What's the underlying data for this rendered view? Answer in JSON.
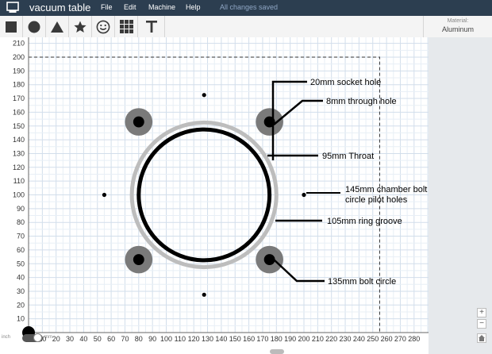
{
  "app": {
    "title": "vacuum table",
    "menu": [
      "File",
      "Edit",
      "Machine",
      "Help"
    ],
    "status": "All changes saved"
  },
  "toolbar": {
    "tools": [
      {
        "name": "rectangle-tool",
        "icon": "square-icon"
      },
      {
        "name": "circle-tool",
        "icon": "circle-icon"
      },
      {
        "name": "triangle-tool",
        "icon": "triangle-icon"
      },
      {
        "name": "star-tool",
        "icon": "star-icon"
      },
      {
        "name": "emoji-tool",
        "icon": "smiley-icon"
      },
      {
        "name": "grid-tool",
        "icon": "grid-icon"
      },
      {
        "name": "text-tool",
        "icon": "text-icon"
      }
    ],
    "material_label": "Material:",
    "material_value": "Aluminum"
  },
  "axis": {
    "x_ticks": [
      10,
      20,
      30,
      40,
      50,
      60,
      70,
      80,
      90,
      100,
      110,
      120,
      130,
      140,
      150,
      160,
      170,
      180,
      190,
      200,
      210,
      220,
      230,
      240,
      250,
      260,
      270,
      280
    ],
    "y_ticks": [
      10,
      20,
      30,
      40,
      50,
      60,
      70,
      80,
      90,
      100,
      110,
      120,
      130,
      140,
      150,
      160,
      170,
      180,
      190,
      200,
      210
    ],
    "work_area": {
      "width_mm": 255,
      "height_mm": 200
    }
  },
  "design": {
    "center_mm": [
      127.5,
      100
    ],
    "outer_ring_diameter_mm": 105,
    "throat_diameter_mm": 95,
    "bolt_holes_mm": [
      [
        80,
        153
      ],
      [
        175,
        153
      ],
      [
        80,
        53
      ],
      [
        175,
        53
      ]
    ],
    "bolt_boss_diameter_mm": 20,
    "bolt_hole_diameter_mm": 8,
    "pilot_holes_mm": [
      [
        127.5,
        172.5
      ],
      [
        55,
        100
      ],
      [
        200,
        100
      ],
      [
        127.5,
        27.5
      ]
    ]
  },
  "annotations": [
    {
      "text": "20mm  socket hole"
    },
    {
      "text": "8mm through hole"
    },
    {
      "text": "95mm  Throat"
    },
    {
      "text": "145mm chamber bolt"
    },
    {
      "text": "circle pilot holes"
    },
    {
      "text": "105mm ring groove"
    },
    {
      "text": "135mm bolt circle"
    }
  ],
  "units": {
    "left": "inch",
    "right": "mm"
  },
  "zoom": {
    "in": "+",
    "out": "−"
  },
  "colors": {
    "topbar": "#2c3e50",
    "grid_minor": "#e3ecf5",
    "grid_major": "#cfdbe8",
    "ring_outer": "#bdbdbd",
    "boss": "#7a7a7a"
  }
}
